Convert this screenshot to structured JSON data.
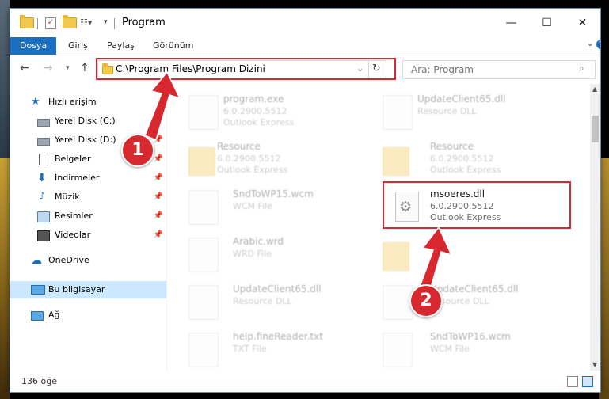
{
  "window": {
    "title": "Program"
  },
  "ribbon": {
    "tabs": [
      "Dosya",
      "Giriş",
      "Paylaş",
      "Görünüm"
    ]
  },
  "address": {
    "path": "C:\\Program Files\\Program Dizini"
  },
  "search": {
    "placeholder": "Ara: Program"
  },
  "sidebar": {
    "items": [
      {
        "label": "Hızlı erişim",
        "icon": "star-icon"
      },
      {
        "label": "Yerel Disk (C:)",
        "icon": "drive-icon"
      },
      {
        "label": "Yerel Disk (D:)",
        "icon": "drive-icon"
      },
      {
        "label": "Belgeler",
        "icon": "document-icon"
      },
      {
        "label": "İndirmeler",
        "icon": "download-icon"
      },
      {
        "label": "Müzik",
        "icon": "music-icon"
      },
      {
        "label": "Resimler",
        "icon": "picture-icon"
      },
      {
        "label": "Videolar",
        "icon": "video-icon"
      },
      {
        "label": "OneDrive",
        "icon": "cloud-icon"
      },
      {
        "label": "Bu bilgisayar",
        "icon": "computer-icon"
      },
      {
        "label": "Ağ",
        "icon": "network-icon"
      }
    ]
  },
  "files": [
    {
      "name": "program.exe",
      "line1": "6.0.2900.5512",
      "line2": "Outlook Express"
    },
    {
      "name": "UpdateClient65.dll",
      "line1": "Resource DLL",
      "line2": ""
    },
    {
      "name": "Resource",
      "line1": "6.0.2900.5512",
      "line2": "Outlook Express"
    },
    {
      "name": "Resource",
      "line1": "6.0.2900.5512",
      "line2": "Outlook Express"
    },
    {
      "name": "SndToWP15.wcm",
      "line1": "WCM File",
      "line2": ""
    },
    {
      "name": "msoeres.dll",
      "line1": "6.0.2900.5512",
      "line2": "Outlook Express"
    },
    {
      "name": "Arabic.wrd",
      "line1": "WRD File",
      "line2": ""
    },
    {
      "name": "",
      "line1": "",
      "line2": ""
    },
    {
      "name": "UpdateClient65.dll",
      "line1": "Resource DLL",
      "line2": ""
    },
    {
      "name": "UpdateClient65.dll",
      "line1": "Resource DLL",
      "line2": ""
    },
    {
      "name": "help.fineReader.txt",
      "line1": "TXT File",
      "line2": ""
    },
    {
      "name": "SndToWP16.wcm",
      "line1": "WCM File",
      "line2": ""
    }
  ],
  "status": {
    "count": "136 öğe"
  },
  "annotations": {
    "badge1": "1",
    "badge2": "2"
  },
  "colors": {
    "highlight": "#d7282f",
    "accent": "#1a6fc2",
    "selected": "#cce8ff"
  }
}
